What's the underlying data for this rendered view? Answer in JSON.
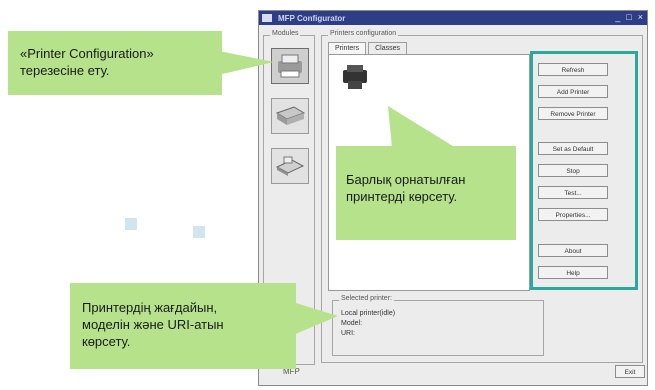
{
  "window": {
    "title": "MFP Configurator",
    "controls": [
      "_",
      "□",
      "×"
    ]
  },
  "modules": {
    "legend": "Modules",
    "items": [
      {
        "icon": "printer-icon",
        "selected": true
      },
      {
        "icon": "scanner-icon",
        "selected": false
      },
      {
        "icon": "port-icon",
        "selected": false
      }
    ]
  },
  "printers_panel": {
    "legend": "Printers configuration",
    "tabs": [
      "Printers",
      "Classes"
    ],
    "active_tab": 0,
    "selected_printer": {
      "legend": "Selected printer:",
      "lines": [
        "Local printer(idle)",
        "Model:",
        "URI:"
      ]
    },
    "buttons": [
      "Refresh",
      "Add Printer",
      "Remove Printer",
      "Set as Default",
      "Stop",
      "Test...",
      "Properties...",
      "About",
      "Help"
    ],
    "exit": "Exit"
  },
  "bottom_label": "MFP",
  "callouts": {
    "config_window": "«Printer Configuration»\nтерезесіне ету.",
    "show_printers": "Барлық орнатылған\nпринтерді көрсету.",
    "printer_status": "Принтердің жағдайын,\nмоделін және URI-атын\nкөрсету."
  },
  "colors": {
    "callout": "#b6e28c",
    "highlight": "#2aa89a",
    "titlebar": "#2e3e86"
  }
}
